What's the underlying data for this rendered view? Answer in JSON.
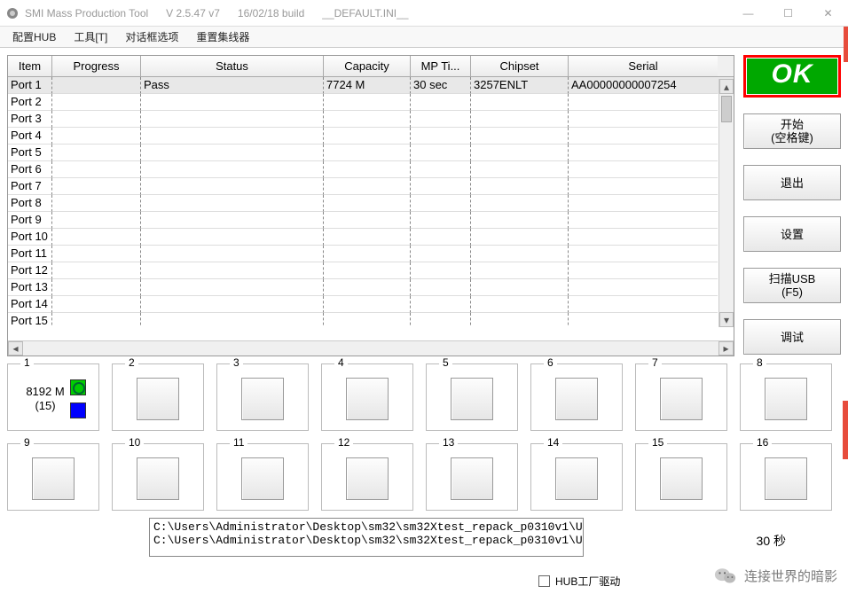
{
  "window": {
    "title_app": "SMI Mass Production Tool",
    "title_ver": "V 2.5.47  v7",
    "title_build": "16/02/18 build",
    "title_ini": "__DEFAULT.INI__"
  },
  "menu": {
    "hub": "配置HUB",
    "tools": "工具[T]",
    "dialog": "对话框选项",
    "reset": "重置集线器"
  },
  "grid": {
    "headers": {
      "item": "Item",
      "progress": "Progress",
      "status": "Status",
      "capacity": "Capacity",
      "mptime": "MP Ti...",
      "chipset": "Chipset",
      "serial": "Serial"
    },
    "rows": [
      {
        "item": "Port 1",
        "progress": "",
        "status": "Pass",
        "capacity": "7724 M",
        "mptime": "30 sec",
        "chipset": "3257ENLT",
        "serial": "AA00000000007254"
      },
      {
        "item": "Port 2",
        "progress": "",
        "status": "",
        "capacity": "",
        "mptime": "",
        "chipset": "",
        "serial": ""
      },
      {
        "item": "Port 3",
        "progress": "",
        "status": "",
        "capacity": "",
        "mptime": "",
        "chipset": "",
        "serial": ""
      },
      {
        "item": "Port 4",
        "progress": "",
        "status": "",
        "capacity": "",
        "mptime": "",
        "chipset": "",
        "serial": ""
      },
      {
        "item": "Port 5",
        "progress": "",
        "status": "",
        "capacity": "",
        "mptime": "",
        "chipset": "",
        "serial": ""
      },
      {
        "item": "Port 6",
        "progress": "",
        "status": "",
        "capacity": "",
        "mptime": "",
        "chipset": "",
        "serial": ""
      },
      {
        "item": "Port 7",
        "progress": "",
        "status": "",
        "capacity": "",
        "mptime": "",
        "chipset": "",
        "serial": ""
      },
      {
        "item": "Port 8",
        "progress": "",
        "status": "",
        "capacity": "",
        "mptime": "",
        "chipset": "",
        "serial": ""
      },
      {
        "item": "Port 9",
        "progress": "",
        "status": "",
        "capacity": "",
        "mptime": "",
        "chipset": "",
        "serial": ""
      },
      {
        "item": "Port 10",
        "progress": "",
        "status": "",
        "capacity": "",
        "mptime": "",
        "chipset": "",
        "serial": ""
      },
      {
        "item": "Port 11",
        "progress": "",
        "status": "",
        "capacity": "",
        "mptime": "",
        "chipset": "",
        "serial": ""
      },
      {
        "item": "Port 12",
        "progress": "",
        "status": "",
        "capacity": "",
        "mptime": "",
        "chipset": "",
        "serial": ""
      },
      {
        "item": "Port 13",
        "progress": "",
        "status": "",
        "capacity": "",
        "mptime": "",
        "chipset": "",
        "serial": ""
      },
      {
        "item": "Port 14",
        "progress": "",
        "status": "",
        "capacity": "",
        "mptime": "",
        "chipset": "",
        "serial": ""
      },
      {
        "item": "Port 15",
        "progress": "",
        "status": "",
        "capacity": "",
        "mptime": "",
        "chipset": "",
        "serial": ""
      }
    ]
  },
  "ok_label": "OK",
  "side": {
    "start_l1": "开始",
    "start_l2": "(空格键)",
    "exit": "退出",
    "settings": "设置",
    "scan_l1": "扫描USB",
    "scan_l2": "(F5)",
    "debug": "调试"
  },
  "ports": {
    "labels": [
      "1",
      "2",
      "3",
      "4",
      "5",
      "6",
      "7",
      "8",
      "9",
      "10",
      "11",
      "12",
      "13",
      "14",
      "15",
      "16"
    ],
    "port1_line1": "8192 M",
    "port1_line2": "(15)"
  },
  "log": {
    "line1": "C:\\Users\\Administrator\\Desktop\\sm32\\sm32Xtest_repack_p0310v1\\U",
    "line2": "C:\\Users\\Administrator\\Desktop\\sm32\\sm32Xtest_repack_p0310v1\\U"
  },
  "hub_checkbox_label": "HUB工厂驱动",
  "timer": "30 秒",
  "watermark": "连接世界的暗影"
}
